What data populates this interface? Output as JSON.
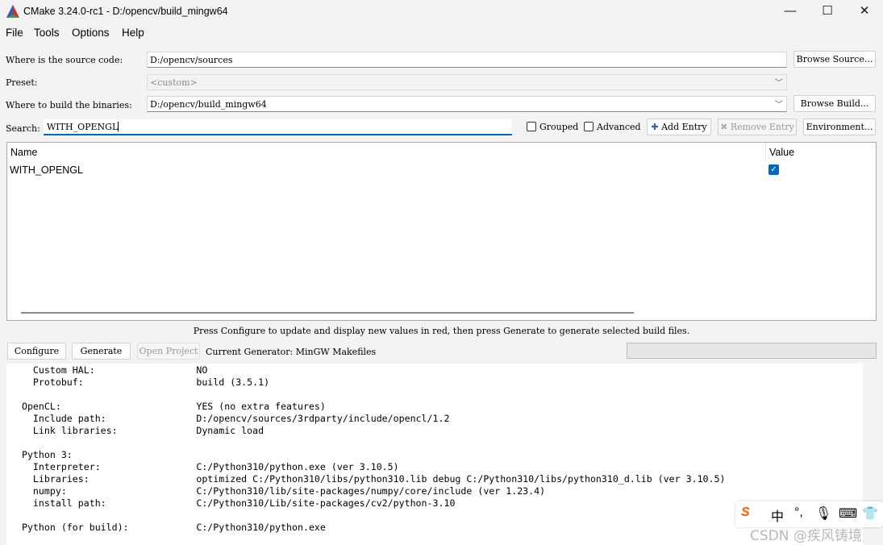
{
  "window": {
    "title": "CMake 3.24.0-rc1 - D:/opencv/build_mingw64",
    "controls": {
      "minimize": "—",
      "maximize": "☐",
      "close": "✕"
    }
  },
  "menu": [
    "File",
    "Tools",
    "Options",
    "Help"
  ],
  "source": {
    "label": "Where is the source code:",
    "value": "D:/opencv/sources",
    "button": "Browse Source..."
  },
  "preset": {
    "label": "Preset:",
    "value": "<custom>"
  },
  "build": {
    "label": "Where to build the binaries:",
    "value": "D:/opencv/build_mingw64",
    "button": "Browse Build..."
  },
  "search": {
    "label": "Search:",
    "value": "WITH_OPENGL"
  },
  "options": {
    "grouped": "Grouped",
    "advanced": "Advanced",
    "add_entry": "Add Entry",
    "remove_entry": "Remove Entry",
    "environment": "Environment..."
  },
  "table": {
    "headers": {
      "name": "Name",
      "value": "Value"
    },
    "rows": [
      {
        "name": "WITH_OPENGL",
        "checked": true
      }
    ]
  },
  "hint": "Press Configure to update and display new values in red, then press Generate to generate selected build files.",
  "actions": {
    "configure": "Configure",
    "generate": "Generate",
    "open_project": "Open Project",
    "current_generator": "Current Generator: MinGW Makefiles"
  },
  "output_lines": [
    "    Custom HAL:                  NO",
    "    Protobuf:                    build (3.5.1)",
    "",
    "  OpenCL:                        YES (no extra features)",
    "    Include path:                D:/opencv/sources/3rdparty/include/opencl/1.2",
    "    Link libraries:              Dynamic load",
    "",
    "  Python 3:",
    "    Interpreter:                 C:/Python310/python.exe (ver 3.10.5)",
    "    Libraries:                   optimized C:/Python310/libs/python310.lib debug C:/Python310/libs/python310_d.lib (ver 3.10.5)",
    "    numpy:                       C:/Python310/lib/site-packages/numpy/core/include (ver 1.23.4)",
    "    install path:                C:/Python310/Lib/site-packages/cv2/python-3.10",
    "",
    "  Python (for build):            C:/Python310/python.exe"
  ],
  "ime": {
    "logo": "S",
    "lang": "中",
    "punct": "°,",
    "mic": "🎙",
    "keyboard": "⌨",
    "skin": "👕"
  },
  "watermark": "CSDN @疾风铸境",
  "colors": {
    "accent": "#0067c0",
    "logo_red": "#d22c2c",
    "logo_green": "#3aa14a",
    "logo_blue": "#2b5fb8"
  }
}
